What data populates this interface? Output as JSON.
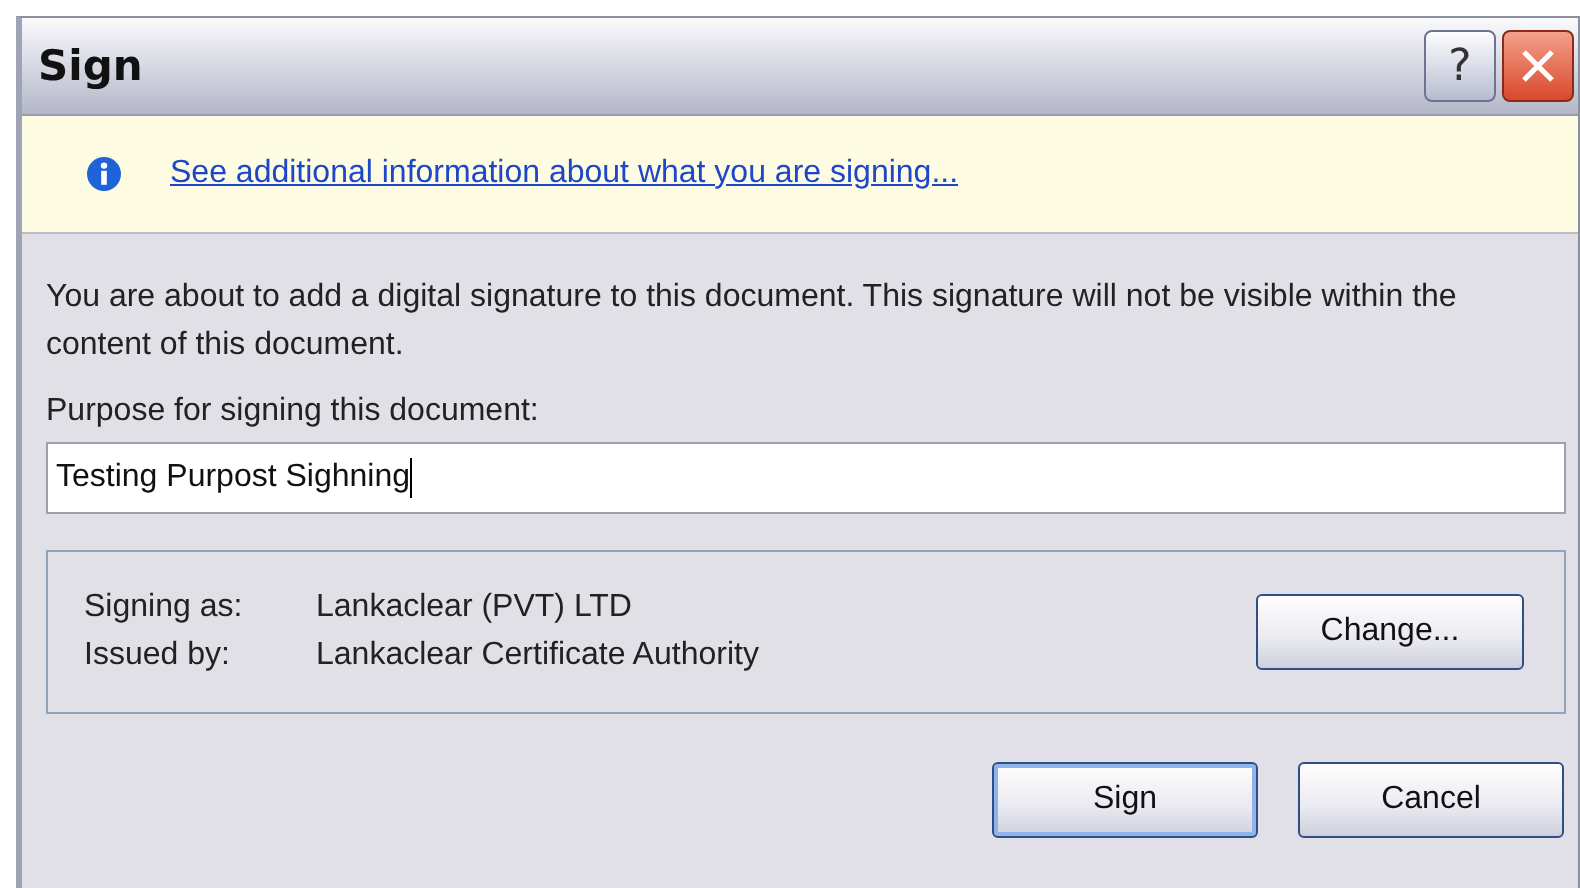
{
  "window": {
    "title": "Sign",
    "help_button": "?"
  },
  "info_bar": {
    "link": "See additional information about what you are signing..."
  },
  "message": "You are about to add a digital signature to this document. This signature will not be visible within the content of this document.",
  "purpose": {
    "label": "Purpose for signing this document:",
    "value": "Testing Purpost Sighning"
  },
  "signer": {
    "rows": [
      {
        "label": "Signing as:",
        "value": "Lankaclear (PVT) LTD"
      },
      {
        "label": "Issued by:",
        "value": "Lankaclear Certificate Authority"
      }
    ],
    "change_button": "Change..."
  },
  "buttons": [
    {
      "label": "Sign",
      "default": true
    },
    {
      "label": "Cancel",
      "default": false
    }
  ]
}
